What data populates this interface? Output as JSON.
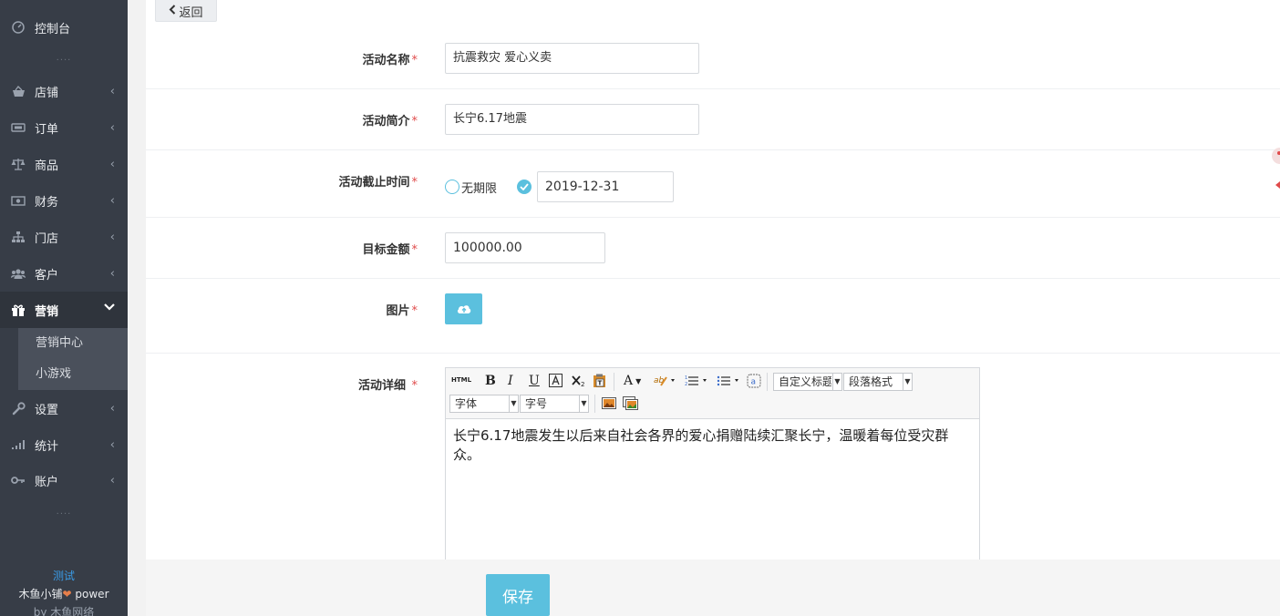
{
  "sidebar": {
    "dashboard": "控制台",
    "items": [
      {
        "label": "店铺",
        "icon": "basket-icon"
      },
      {
        "label": "订单",
        "icon": "ticket-icon"
      },
      {
        "label": "商品",
        "icon": "scale-icon"
      },
      {
        "label": "财务",
        "icon": "money-icon"
      },
      {
        "label": "门店",
        "icon": "sitemap-icon"
      },
      {
        "label": "客户",
        "icon": "users-icon"
      }
    ],
    "marketing": "营销",
    "sub_items": [
      "营销中心",
      "小游戏"
    ],
    "bottom_items": [
      {
        "label": "设置",
        "icon": "wrench-icon"
      },
      {
        "label": "统计",
        "icon": "signal-icon"
      },
      {
        "label": "账户",
        "icon": "key-icon"
      }
    ],
    "dots": "....",
    "footer_test": "测试",
    "footer_brand": "木鱼小铺",
    "footer_power": "power",
    "footer_by": "by 木鱼网络"
  },
  "header": {
    "back_label": "返回"
  },
  "form": {
    "name_label": "活动名称",
    "name_value": "抗震救灾 爱心义卖",
    "intro_label": "活动简介",
    "intro_value": "长宁6.17地震",
    "deadline_label": "活动截止时间",
    "deadline_unlimited": "无期限",
    "deadline_value": "2019-12-31",
    "target_label": "目标金额",
    "target_value": "100000.00",
    "image_label": "图片",
    "detail_label": "活动详细",
    "required_mark": "*"
  },
  "editor": {
    "html_btn": "HTML",
    "bold": "B",
    "italic": "I",
    "underline": "U",
    "font_color": "A",
    "custom_heading": "自定义标题",
    "paragraph_format": "段落格式",
    "font_family": "字体",
    "font_size": "字号",
    "content": "长宁6.17地震发生以后来自社会各界的爱心捐赠陆续汇聚长宁，温暖着每位受灾群众。"
  },
  "footer": {
    "save_label": "保存"
  },
  "colors": {
    "accent": "#5bc0de",
    "sidebar_bg": "#373d47",
    "required": "#e04b4b"
  }
}
